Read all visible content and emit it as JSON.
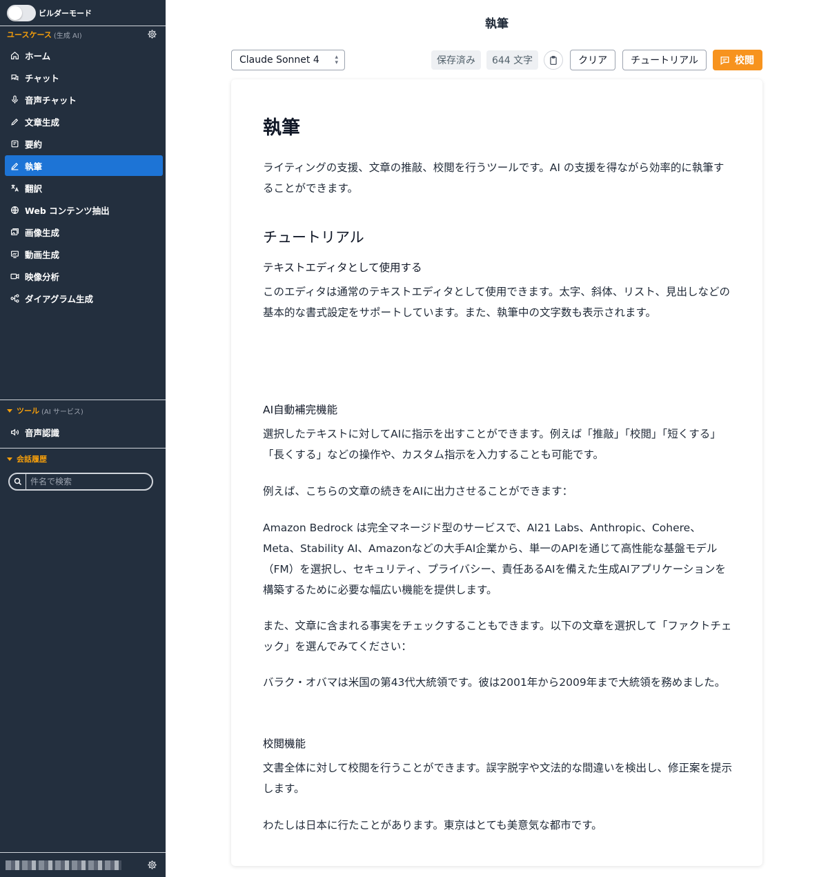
{
  "sidebar": {
    "builder_mode_label": "ビルダーモード",
    "usecase_section": {
      "title": "ユースケース",
      "subtitle": "(生成 AI)"
    },
    "items": [
      {
        "label": "ホーム",
        "icon": "home-icon"
      },
      {
        "label": "チャット",
        "icon": "chat-icon"
      },
      {
        "label": "音声チャット",
        "icon": "microphone-icon"
      },
      {
        "label": "文章生成",
        "icon": "pencil-icon"
      },
      {
        "label": "要約",
        "icon": "summary-icon"
      },
      {
        "label": "執筆",
        "icon": "writing-icon",
        "active": true
      },
      {
        "label": "翻訳",
        "icon": "translate-icon"
      },
      {
        "label": "Web コンテンツ抽出",
        "icon": "globe-icon"
      },
      {
        "label": "画像生成",
        "icon": "image-icon"
      },
      {
        "label": "動画生成",
        "icon": "video-icon"
      },
      {
        "label": "映像分析",
        "icon": "camera-icon"
      },
      {
        "label": "ダイアグラム生成",
        "icon": "diagram-icon"
      }
    ],
    "tools_section": {
      "title": "ツール",
      "subtitle": "(AI サービス)"
    },
    "tools_items": [
      {
        "label": "音声認識",
        "icon": "speaker-icon"
      }
    ],
    "history_section": {
      "title": "会話履歴"
    },
    "search_placeholder": "件名で検索"
  },
  "page": {
    "title": "執筆"
  },
  "toolbar": {
    "model": "Claude Sonnet 4",
    "saved_badge": "保存済み",
    "char_count": "644 文字",
    "clear_label": "クリア",
    "tutorial_label": "チュートリアル",
    "proofread_label": "校閲"
  },
  "editor": {
    "h1": "執筆",
    "intro": "ライティングの支援、文章の推敲、校閲を行うツールです。AI の支援を得ながら効率的に執筆することができます。",
    "h2_tutorial": "チュートリアル",
    "h3_text_editor": "テキストエディタとして使用する",
    "p_text_editor": "このエディタは通常のテキストエディタとして使用できます。太字、斜体、リスト、見出しなどの基本的な書式設定をサポートしています。また、執筆中の文字数も表示されます。",
    "h3_autocomplete": "AI自動補完機能",
    "p_autocomplete": "選択したテキストに対してAIに指示を出すことができます。例えば「推敲」「校閲」「短くする」「長くする」などの操作や、カスタム指示を入力することも可能です。",
    "p_example": "例えば、こちらの文章の続きをAIに出力させることができます：",
    "p_bedrock": "Amazon Bedrock は完全マネージド型のサービスで、AI21 Labs、Anthropic、Cohere、Meta、Stability AI、Amazonなどの大手AI企業から、単一のAPIを通じて高性能な基盤モデル（FM）を選択し、セキュリティ、プライバシー、責任あるAIを備えた生成AIアプリケーションを構築するために必要な幅広い機能を提供します。",
    "p_factcheck": "また、文章に含まれる事実をチェックすることもできます。以下の文章を選択して「ファクトチェック」を選んでみてください：",
    "p_obama": "バラク・オバマは米国の第43代大統領です。彼は2001年から2009年まで大統領を務めました。",
    "h3_proofread": "校閲機能",
    "p_proofread": "文書全体に対して校閲を行うことができます。誤字脱字や文法的な間違いを検出し、修正案を提示します。",
    "p_japan": "わたしは日本に行たことがあります。東京はとても美意気な都市です。"
  },
  "colors": {
    "sidebar_bg": "#232f3e",
    "active_item": "#1d74d6",
    "accent_orange": "#f7931e",
    "section_orange": "#f59e0b"
  }
}
